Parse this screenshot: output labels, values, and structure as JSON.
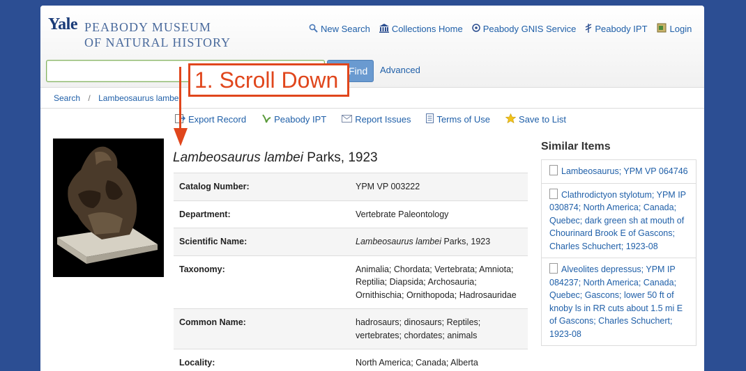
{
  "logo": {
    "yale": "Yale",
    "line1": "PEABODY MUSEUM",
    "line2": "OF NATURAL HISTORY"
  },
  "topnav": [
    {
      "label": "New Search",
      "icon": "search-icon"
    },
    {
      "label": "Collections Home",
      "icon": "building-icon"
    },
    {
      "label": "Peabody GNIS Service",
      "icon": "compass-icon"
    },
    {
      "label": "Peabody IPT",
      "icon": "plant-icon"
    },
    {
      "label": "Login",
      "icon": "login-icon"
    }
  ],
  "search": {
    "value": "",
    "find_label": "Find",
    "advanced_label": "Advanced"
  },
  "breadcrumb": {
    "root": "Search",
    "current": "Lambeosaurus lambei"
  },
  "actions": [
    {
      "label": "Export Record",
      "icon": "export-icon"
    },
    {
      "label": "Peabody IPT",
      "icon": "plant-icon"
    },
    {
      "label": "Report Issues",
      "icon": "mail-icon"
    },
    {
      "label": "Terms of Use",
      "icon": "document-icon"
    },
    {
      "label": "Save to List",
      "icon": "star-icon"
    }
  ],
  "record": {
    "title_italic": "Lambeosaurus lambei",
    "title_rest": " Parks, 1923",
    "fields": [
      {
        "label": "Catalog Number:",
        "value": "YPM VP 003222"
      },
      {
        "label": "Department:",
        "value": "Vertebrate Paleontology"
      },
      {
        "label": "Scientific Name:",
        "value_italic": "Lambeosaurus lambei",
        "value": " Parks, 1923"
      },
      {
        "label": "Taxonomy:",
        "value": "Animalia; Chordata; Vertebrata; Amniota; Reptilia; Diapsida; Archosauria; Ornithischia; Ornithopoda; Hadrosauridae"
      },
      {
        "label": "Common Name:",
        "value": "hadrosaurs; dinosaurs; Reptiles; vertebrates; chordates; animals"
      },
      {
        "label": "Locality:",
        "value": "North America; Canada; Alberta"
      }
    ]
  },
  "similar": {
    "title": "Similar Items",
    "items": [
      "Lambeosaurus; YPM VP 064746",
      "Clathrodictyon stylotum; YPM IP 030874; North America; Canada; Quebec; dark green sh at mouth of Chourinard Brook E of Gascons; Charles Schuchert; 1923-08",
      "Alveolites depressus; YPM IP 084237; North America; Canada; Quebec; Gascons; lower 50 ft of knoby ls in RR cuts about 1.5 mi E of Gascons; Charles Schuchert; 1923-08"
    ]
  },
  "annotation": {
    "text": "1. Scroll Down",
    "color": "#e0461c"
  }
}
